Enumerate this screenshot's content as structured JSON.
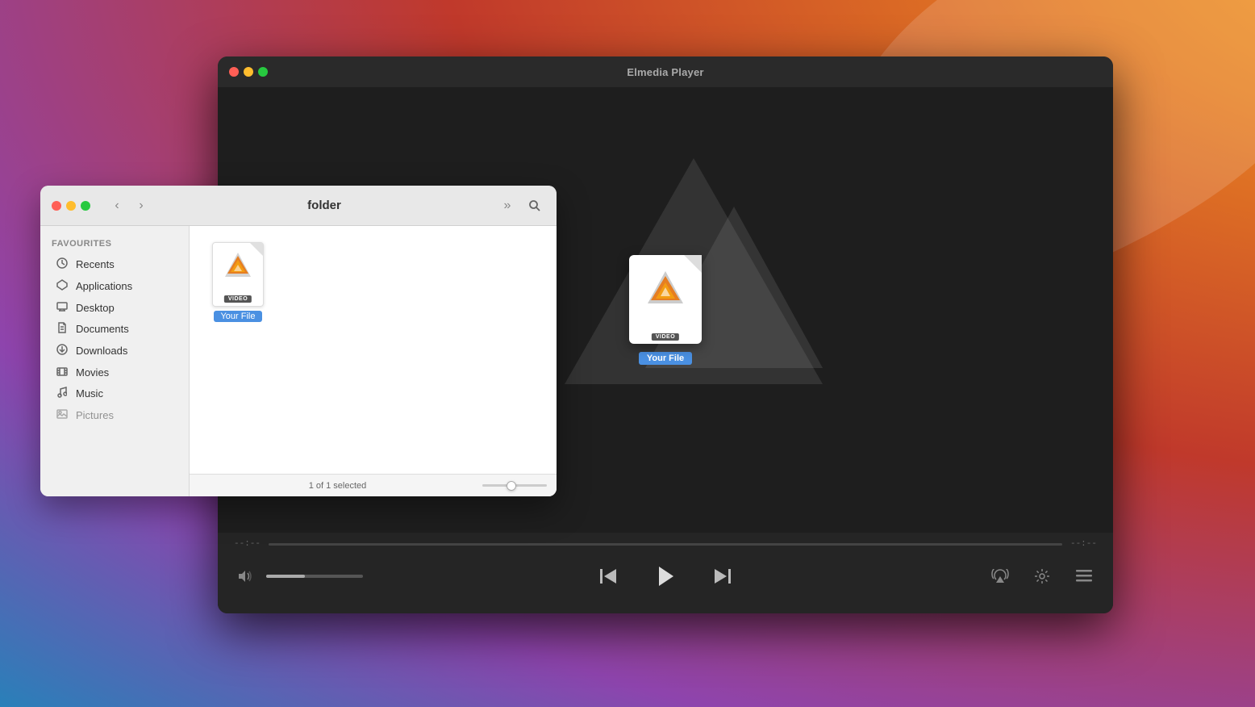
{
  "wallpaper": {
    "colors": [
      "#c0392b",
      "#e67e22",
      "#8e44ad",
      "#2980b9"
    ]
  },
  "player": {
    "title": "Elmedia Player",
    "traffic_lights": [
      "red",
      "yellow",
      "green"
    ],
    "time_start": "--:--",
    "time_end": "--:--",
    "file": {
      "name": "Your File",
      "badge": "VIDEO"
    },
    "controls": {
      "play": "▶",
      "prev": "⏮",
      "next": "⏭",
      "volume_icon": "🔊",
      "airplay_icon": "⎋",
      "settings_icon": "⚙",
      "list_icon": "☰"
    }
  },
  "finder": {
    "title": "folder",
    "traffic_lights": [
      "red",
      "yellow",
      "green"
    ],
    "sidebar": {
      "section_label": "Favourites",
      "items": [
        {
          "label": "Recents",
          "icon": "clock"
        },
        {
          "label": "Applications",
          "icon": "rocket"
        },
        {
          "label": "Desktop",
          "icon": "display"
        },
        {
          "label": "Documents",
          "icon": "doc"
        },
        {
          "label": "Downloads",
          "icon": "arrow-down-circle"
        },
        {
          "label": "Movies",
          "icon": "film"
        },
        {
          "label": "Music",
          "icon": "music"
        },
        {
          "label": "Pictures",
          "icon": "photo"
        }
      ]
    },
    "file": {
      "name": "Your File",
      "badge": "VIDEO"
    },
    "statusbar": {
      "text": "1 of 1 selected"
    }
  }
}
